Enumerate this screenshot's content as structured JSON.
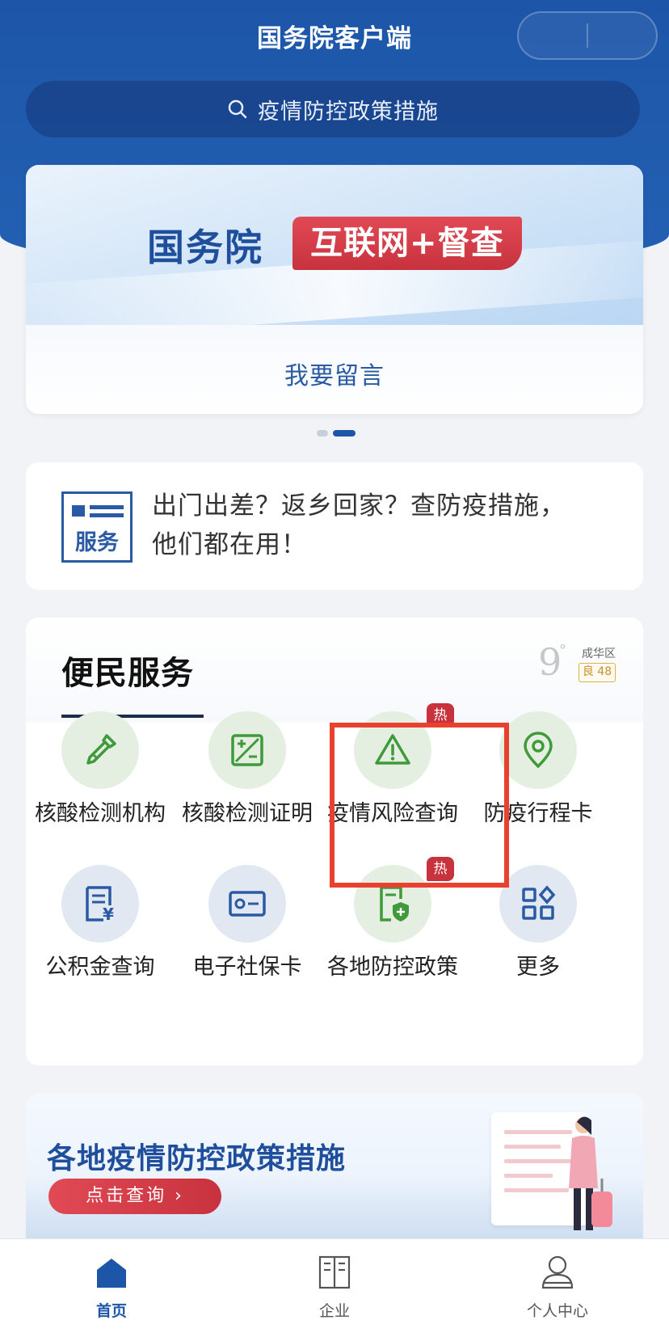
{
  "header": {
    "title": "国务院客户端",
    "search_placeholder": "疫情防控政策措施"
  },
  "banner": {
    "brand": "国务院",
    "tag": "互联网+督查",
    "cta": "我要留言",
    "pages": 2,
    "active_page": 2
  },
  "notice": {
    "icon_label": "服务",
    "line1": "出门出差？返乡回家？查防疫措施，",
    "line2": "他们都在用！"
  },
  "services": {
    "title": "便民服务",
    "weather": {
      "temp": "9",
      "unit": "°",
      "area": "成华区",
      "aqi": "良 48"
    },
    "items": [
      {
        "label": "核酸检测机构",
        "icon": "dropper-icon",
        "color": "green",
        "hot": ""
      },
      {
        "label": "核酸检测证明",
        "icon": "plus-minus-icon",
        "color": "green",
        "hot": ""
      },
      {
        "label": "疫情风险查询",
        "icon": "warning-icon",
        "color": "green",
        "hot": "热"
      },
      {
        "label": "防疫行程卡",
        "icon": "location-pin-icon",
        "color": "green",
        "hot": ""
      },
      {
        "label": "公积金查询",
        "icon": "fund-document-icon",
        "color": "blue",
        "hot": ""
      },
      {
        "label": "电子社保卡",
        "icon": "id-card-icon",
        "color": "blue",
        "hot": ""
      },
      {
        "label": "各地防控政策",
        "icon": "shield-document-icon",
        "color": "green",
        "hot": "热"
      },
      {
        "label": "更多",
        "icon": "grid-more-icon",
        "color": "blue",
        "hot": ""
      }
    ]
  },
  "policy": {
    "title": "各地疫情防控政策措施",
    "button": "点击查询 ›"
  },
  "tabbar": {
    "tabs": [
      {
        "label": "首页",
        "icon": "home-icon",
        "active": true
      },
      {
        "label": "企业",
        "icon": "building-icon",
        "active": false
      },
      {
        "label": "个人中心",
        "icon": "person-icon",
        "active": false
      }
    ]
  },
  "colors": {
    "brand_blue": "#1d56a8",
    "accent_red": "#c8323d",
    "icon_green": "#3f9a3a",
    "icon_blue": "#2a5aa3",
    "highlight_red": "#e8412f"
  }
}
